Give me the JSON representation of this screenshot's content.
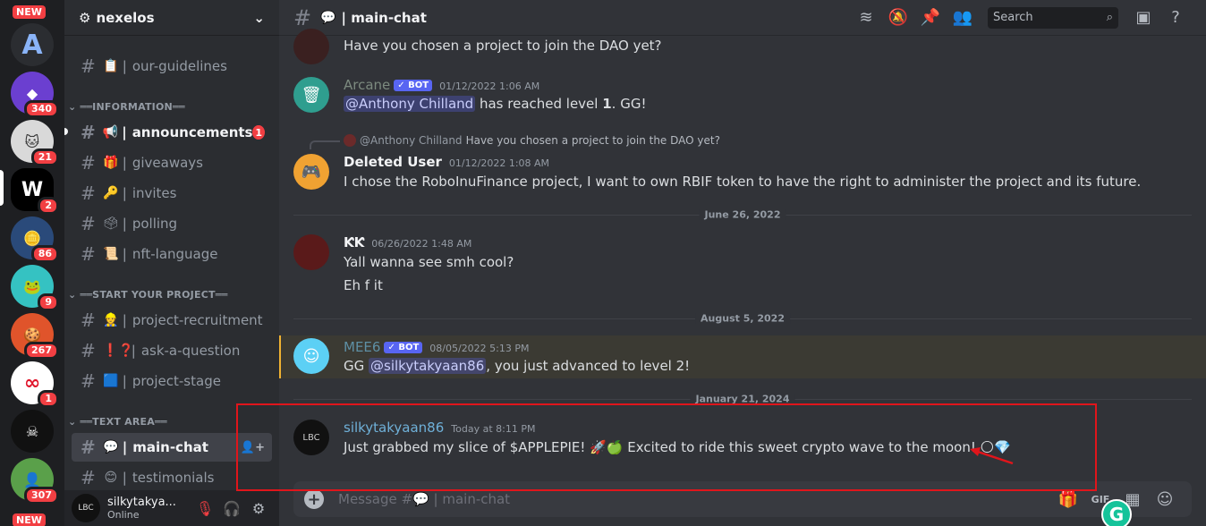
{
  "colors": {
    "accent": "#5865f2",
    "danger": "#f23f43",
    "annotation": "#e0151b",
    "grammarly": "#15c39a"
  },
  "rail": {
    "new_top": "NEW",
    "new_bottom": "NEW",
    "servers": [
      {
        "name": "server-a",
        "badge": ""
      },
      {
        "name": "server-purple",
        "badge": "340"
      },
      {
        "name": "server-cat",
        "badge": "21"
      },
      {
        "name": "server-w",
        "badge": "2"
      },
      {
        "name": "server-coin",
        "badge": "86"
      },
      {
        "name": "server-frog",
        "badge": "9"
      },
      {
        "name": "server-cookie",
        "badge": "267"
      },
      {
        "name": "server-infinity",
        "badge": "1"
      },
      {
        "name": "server-skull",
        "badge": ""
      },
      {
        "name": "server-portrait",
        "badge": "307"
      }
    ]
  },
  "sidebar": {
    "guild_name": "nexelos",
    "categories": {
      "information": "INFORMATION",
      "start": "START YOUR PROJECT",
      "text": "TEXT AREA"
    },
    "channels": [
      {
        "emoji": "📋",
        "name": "our-guidelines"
      },
      {
        "emoji": "📢",
        "name": "announcements",
        "badge": "1"
      },
      {
        "emoji": "🎁",
        "name": "giveaways"
      },
      {
        "emoji": "🔑",
        "name": "invites"
      },
      {
        "emoji": "🗳",
        "name": "polling"
      },
      {
        "emoji": "📜",
        "name": "nft-language"
      },
      {
        "emoji": "👷",
        "name": "project-recruitment"
      },
      {
        "emoji": "❗❓",
        "name": "ask-a-question"
      },
      {
        "emoji": "🟦",
        "name": "project-stage"
      },
      {
        "emoji": "💬",
        "name": "main-chat"
      },
      {
        "emoji": "😊",
        "name": "testimonials"
      }
    ],
    "user": {
      "name": "silkytakya...",
      "status": "Online"
    }
  },
  "topbar": {
    "emoji": "💬",
    "channel": "| main-chat",
    "search_placeholder": "Search"
  },
  "messages": {
    "m0": {
      "text": "Have you chosen a project to join the DAO yet?"
    },
    "m1": {
      "author": "Arcane",
      "bot": "BOT",
      "ts": "01/12/2022 1:06 AM",
      "mention": "@Anthony Chilland",
      "text_a": " has reached level ",
      "level": "1",
      "text_b": ". GG!"
    },
    "m2": {
      "reply_author": "@Anthony Chilland",
      "reply_text": "Have you chosen a project to join the DAO yet?",
      "author": "Deleted User",
      "ts": "01/12/2022 1:08 AM",
      "text": "I chose the RoboInuFinance project, I want to own RBIF token to have the right to administer the project and its future."
    },
    "d1": "June 26, 2022",
    "m3": {
      "author": "ƘƘ",
      "ts": "06/26/2022 1:48 AM",
      "text1": "Yall wanna see smh cool?",
      "text2": "Eh f it"
    },
    "d2": "August 5, 2022",
    "m4": {
      "author": "MEE6",
      "bot": "BOT",
      "ts": "08/05/2022 5:13 PM",
      "text_a": "GG ",
      "mention": "@silkytakyaan86",
      "text_b": ", you just advanced to level 2!"
    },
    "d3": "January 21, 2024",
    "m5": {
      "author": "silkytakyaan86",
      "ts": "Today at 8:11 PM",
      "text": "Just grabbed my slice of $APPLEPIE! 🚀🍏 Excited to ride this sweet crypto wave to the moon! 🌕💎"
    }
  },
  "composer": {
    "placeholder": "Message #💬 | main-chat",
    "gif": "GIF"
  },
  "grammarly": "G"
}
